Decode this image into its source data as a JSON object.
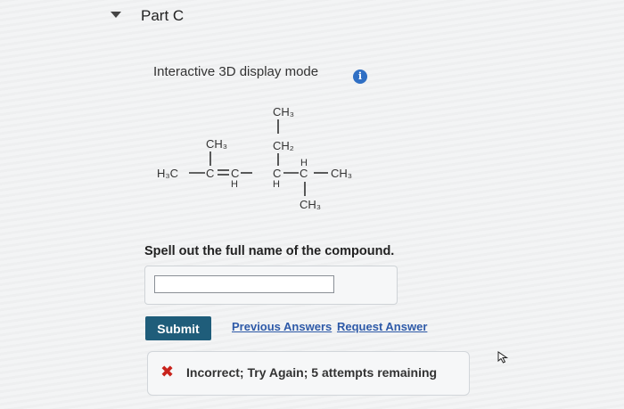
{
  "part": {
    "title": "Part C"
  },
  "display_mode": {
    "label": "Interactive 3D display mode",
    "info_icon": "info-icon"
  },
  "structure": {
    "main_chain_left": "H₃C",
    "c1": "C",
    "c2": "C",
    "c2_h": "H",
    "c3": "C",
    "c3_h": "H",
    "c4_h": "H",
    "c4": "C",
    "main_chain_right": "CH₃",
    "c1_substituent": "CH₃",
    "c3_substituent_ch2": "CH₂",
    "c3_substituent_ch3": "CH₃",
    "c4_substituent": "CH₃"
  },
  "question": {
    "text": "Spell out the full name of the compound."
  },
  "answer": {
    "value": "",
    "placeholder": ""
  },
  "actions": {
    "submit_label": "Submit",
    "previous_answers_label": "Previous Answers",
    "request_answer_label": "Request Answer"
  },
  "feedback": {
    "icon": "x-icon",
    "mark": "✖",
    "text": "Incorrect; Try Again; 5 attempts remaining",
    "color": "#c8231c"
  },
  "colors": {
    "submit_bg": "#1f5d7a",
    "link": "#2e5aa8",
    "info": "#2f6fc4"
  }
}
